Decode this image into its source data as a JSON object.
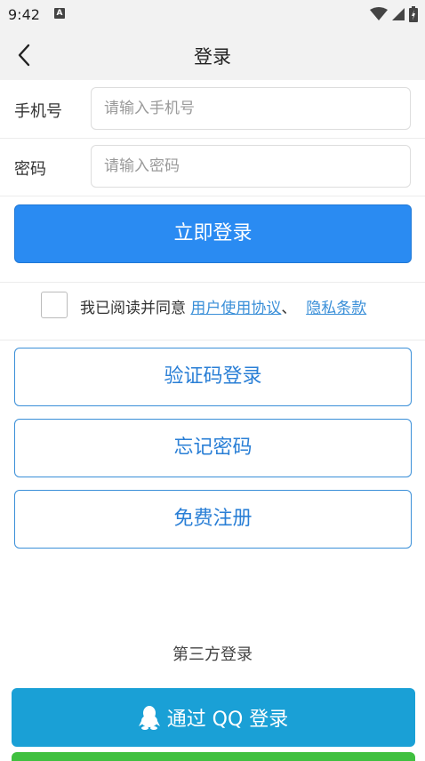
{
  "status_bar": {
    "time": "9:42",
    "notification_letter": "A"
  },
  "nav": {
    "title": "登录"
  },
  "form": {
    "phone": {
      "label": "手机号",
      "placeholder": "请输入手机号"
    },
    "password": {
      "label": "密码",
      "placeholder": "请输入密码"
    }
  },
  "login_button": "立即登录",
  "agreement": {
    "prefix": "我已阅读并同意 ",
    "terms_link": "用户使用协议",
    "separator": "、",
    "privacy_link": "隐私条款"
  },
  "alt_actions": {
    "sms_login": "验证码登录",
    "forgot_password": "忘记密码",
    "register": "免费注册"
  },
  "third_party": {
    "title": "第三方登录",
    "qq_button": "通过 QQ 登录"
  },
  "colors": {
    "primary": "#2a8bf2",
    "link": "#3a8fd8",
    "qq": "#1aa0d6",
    "wechat_green": "#3fc03f"
  }
}
